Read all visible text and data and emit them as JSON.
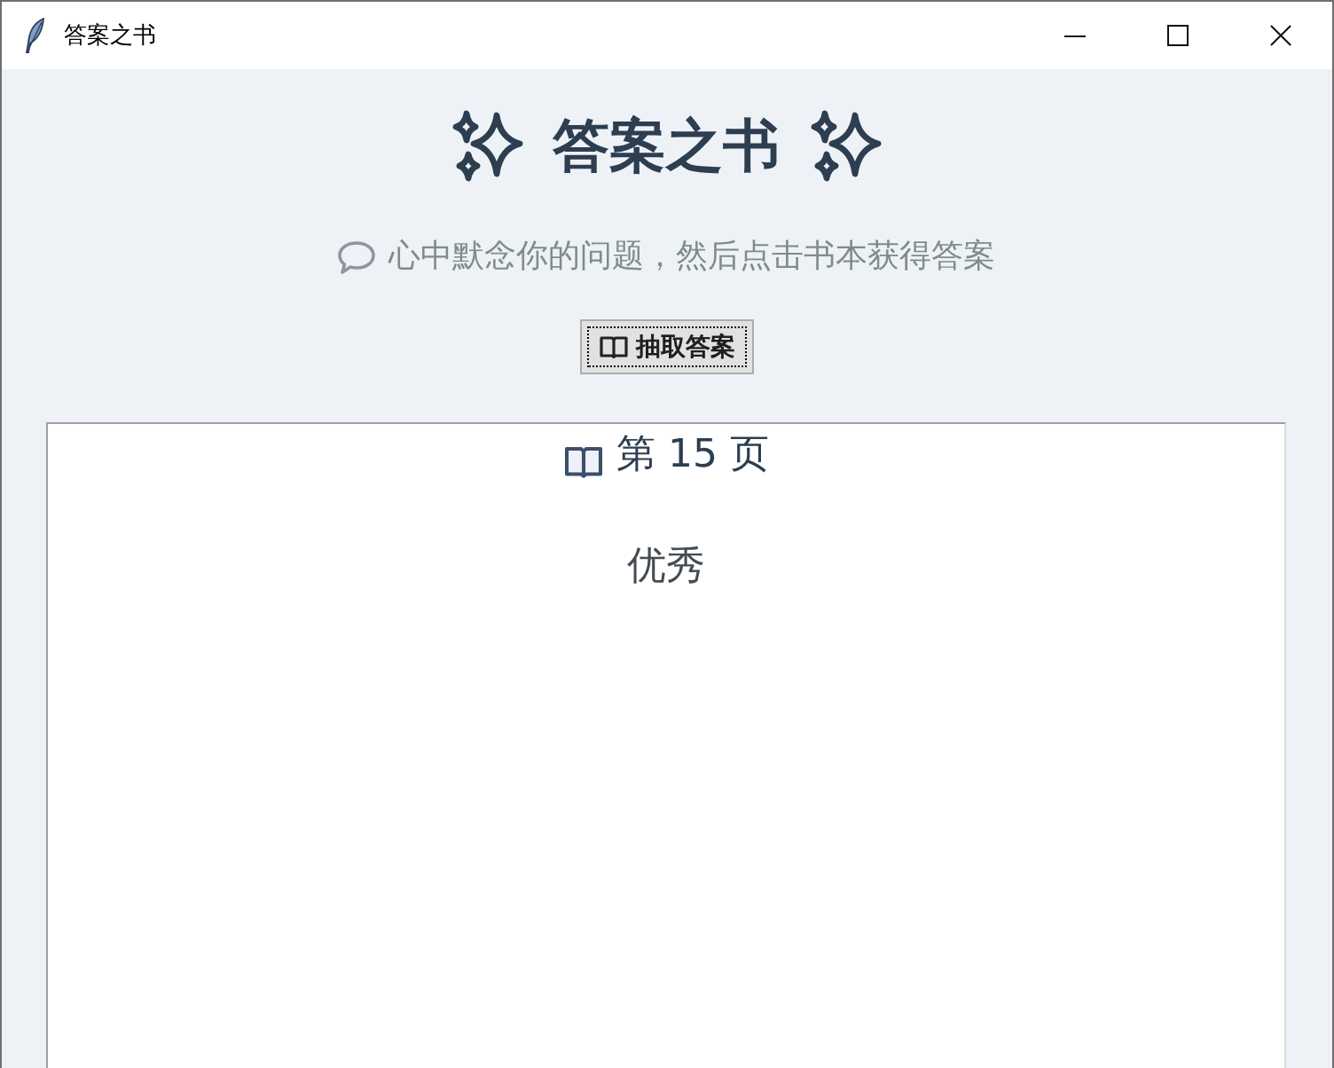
{
  "window": {
    "title": "答案之书"
  },
  "header": {
    "title": "答案之书"
  },
  "prompt": {
    "text": "心中默念你的问题，然后点击书本获得答案"
  },
  "draw_button": {
    "label": "抽取答案",
    "focused": true
  },
  "answer": {
    "page": "第 15 页",
    "text": "优秀"
  }
}
